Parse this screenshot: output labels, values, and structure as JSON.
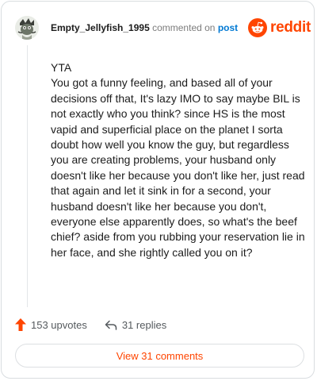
{
  "header": {
    "author": "Empty_Jellyfish_1995",
    "action": "commented on",
    "post_link": "post",
    "brand": "reddit"
  },
  "comment": {
    "text": "YTA\nYou got a funny feeling, and based all of your decisions off that, It's lazy IMO to say maybe BIL is not exactly who you think? since HS is the most vapid and superficial place on the planet I sorta doubt how well you know the guy, but regardless you are creating problems, your husband only doesn't like her because you don't like her, just read that again and let it sink in for a second, your husband doesn't like her because you don't, everyone else apparently does, so what's the beef chief? aside from you rubbing your reservation lie in her face, and she rightly called you on it?"
  },
  "footer": {
    "upvotes": "153 upvotes",
    "replies": "31 replies",
    "view_comments": "View 31 comments"
  },
  "icons": {
    "upvote": "upvote-arrow-icon",
    "reply": "reply-arrow-icon",
    "logo": "reddit-snoo-icon",
    "avatar": "user-avatar"
  },
  "colors": {
    "brand": "#ff4500",
    "link": "#0079d3",
    "muted": "#7c7c7c",
    "border": "#d9dde0"
  }
}
